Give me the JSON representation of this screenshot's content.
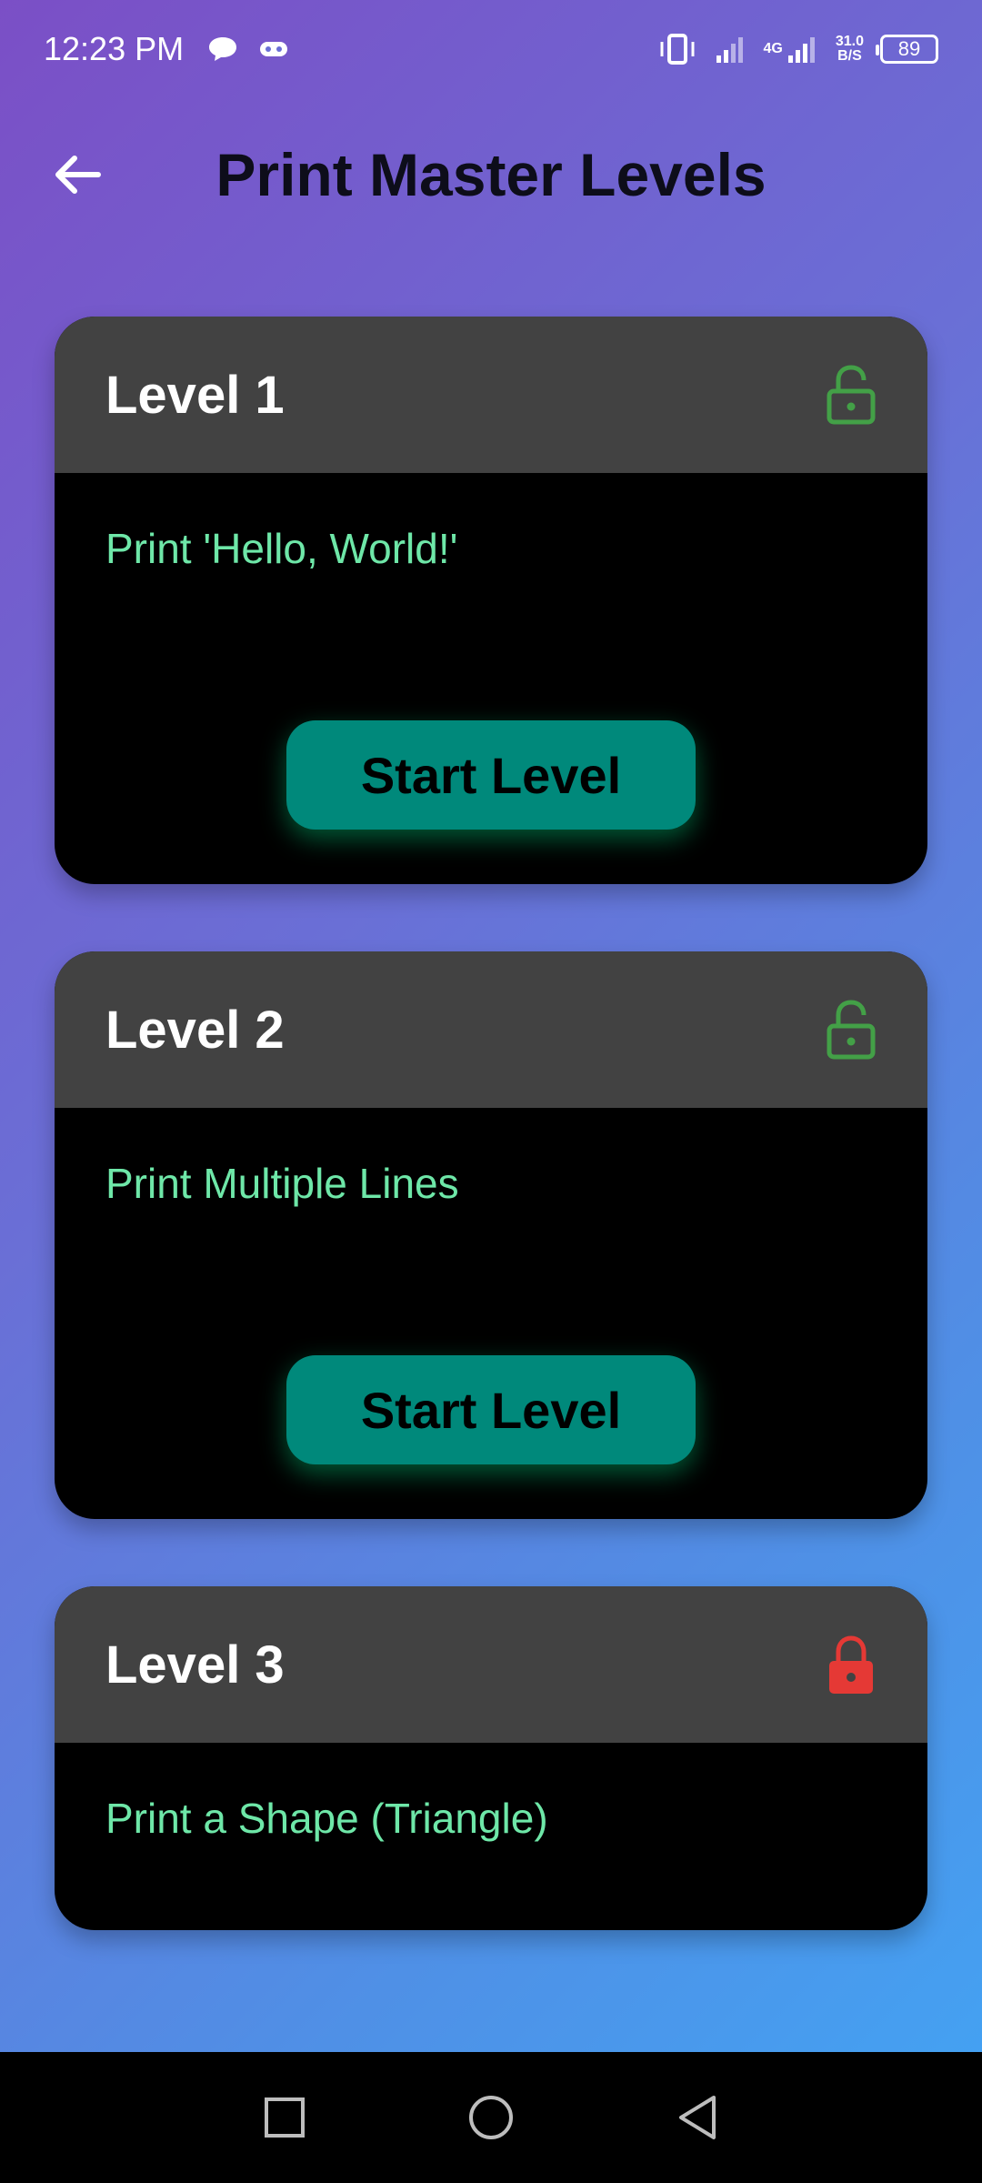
{
  "status_bar": {
    "time": "12:23 PM",
    "network": "4G",
    "speed_value": "31.0",
    "speed_unit": "B/S",
    "battery": "89"
  },
  "app_bar": {
    "title": "Print Master Levels",
    "back_icon": "arrow-left-icon"
  },
  "levels": [
    {
      "title": "Level 1",
      "description": "Print 'Hello, World!'",
      "locked": false,
      "button_label": "Start Level"
    },
    {
      "title": "Level 2",
      "description": "Print Multiple Lines",
      "locked": false,
      "button_label": "Start Level"
    },
    {
      "title": "Level 3",
      "description": "Print a Shape (Triangle)",
      "locked": true
    }
  ],
  "colors": {
    "unlocked": "#43a047",
    "locked": "#e53935",
    "accent": "#00897b",
    "description": "#6ee7a8"
  },
  "nav_bar": {
    "recents_icon": "square-icon",
    "home_icon": "circle-icon",
    "back_icon": "triangle-back-icon"
  }
}
